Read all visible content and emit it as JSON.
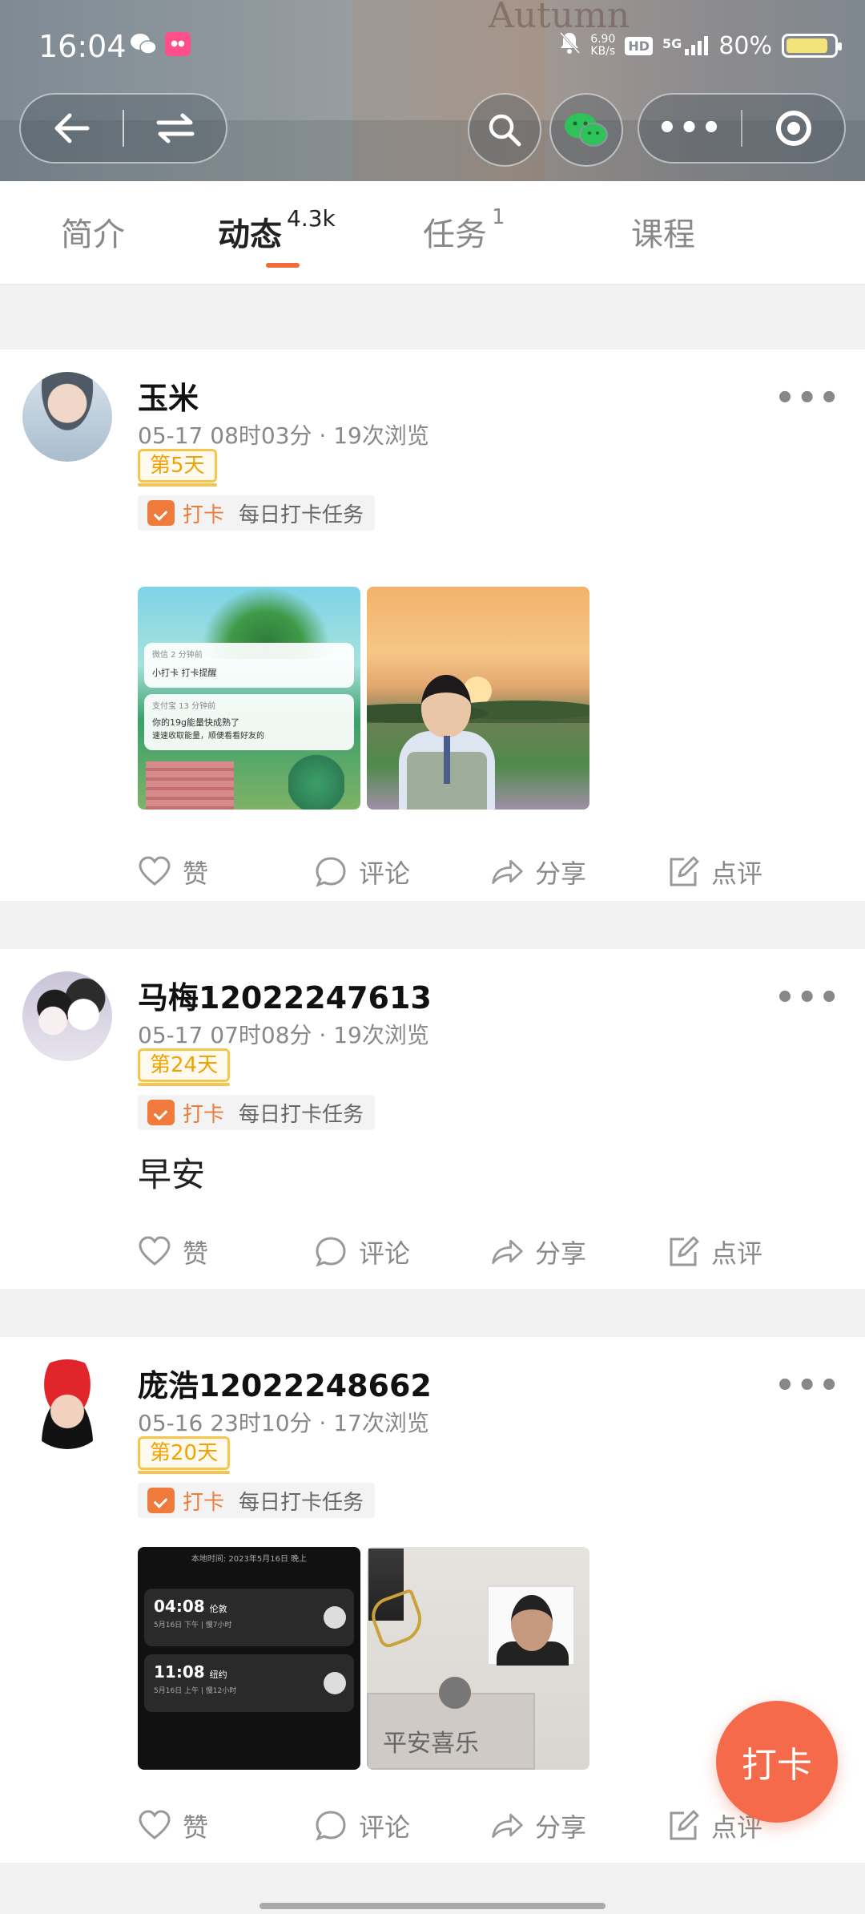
{
  "status_bar": {
    "time": "16:04",
    "net_speed_value": "6.90",
    "net_speed_unit": "KB/s",
    "hd": "HD",
    "signal": "5G",
    "battery": "80%"
  },
  "header_bg_text": "Autumn",
  "tabs": [
    {
      "label": "简介",
      "badge": ""
    },
    {
      "label": "动态",
      "badge": "4.3k"
    },
    {
      "label": "任务",
      "badge": "1"
    },
    {
      "label": "课程",
      "badge": ""
    }
  ],
  "active_tab": "动态",
  "posts": [
    {
      "name": "玉米",
      "time": "05-17 08时03分",
      "views": "19次浏览",
      "day": "第5天",
      "task_label": "打卡",
      "task_name": "每日打卡任务",
      "text": "",
      "img1_notif1_app": "微信  2 分钟前",
      "img1_notif1_text": "小打卡  打卡提醒",
      "img1_notif2_app": "支付宝  13 分钟前",
      "img1_notif2_text": "你的19g能量快成熟了",
      "img1_notif2_sub": "速速收取能量，顺便看看好友的"
    },
    {
      "name": "马梅12022247613",
      "time": "05-17 07时08分",
      "views": "19次浏览",
      "day": "第24天",
      "task_label": "打卡",
      "task_name": "每日打卡任务",
      "text": "早安"
    },
    {
      "name": "庞浩12022248662",
      "time": "05-16 23时10分",
      "views": "17次浏览",
      "day": "第20天",
      "task_label": "打卡",
      "task_name": "每日打卡任务",
      "text": "",
      "img1_header": "本地时间: 2023年5月16日 晚上",
      "clock1_time": "04:08",
      "clock1_city": "伦敦",
      "clock1_sub": "5月16日 下午 | 慢7小时",
      "clock2_time": "11:08",
      "clock2_city": "纽约",
      "clock2_sub": "5月16日 上午 | 慢12小时",
      "img2_writing": "平安喜乐"
    }
  ],
  "actions": {
    "like": "赞",
    "comment": "评论",
    "share": "分享",
    "review": "点评"
  },
  "fab_label": "打卡",
  "colors": {
    "accent": "#f06a3c",
    "badge_yellow": "#f5c64b",
    "fab": "#f46a4a"
  }
}
